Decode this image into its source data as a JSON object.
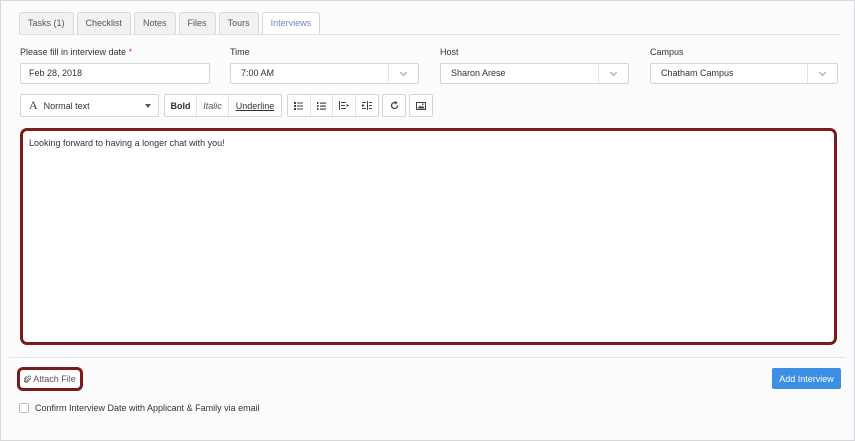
{
  "tabs": [
    {
      "label": "Tasks (1)",
      "active": false
    },
    {
      "label": "Checklist",
      "active": false
    },
    {
      "label": "Notes",
      "active": false
    },
    {
      "label": "Files",
      "active": false
    },
    {
      "label": "Tours",
      "active": false
    },
    {
      "label": "Interviews",
      "active": true
    }
  ],
  "form": {
    "date_label": "Please fill in interview date",
    "date_required_mark": "*",
    "date_value": "Feb 28, 2018",
    "time_label": "Time",
    "time_value": "7:00 AM",
    "host_label": "Host",
    "host_value": "Sharon Arese",
    "campus_label": "Campus",
    "campus_value": "Chatham Campus"
  },
  "toolbar": {
    "format_icon": "A",
    "format_value": "Normal text",
    "bold": "Bold",
    "italic": "Italic",
    "underline": "Underline",
    "icons": [
      "bullet-list-icon",
      "numbered-list-icon",
      "outdent-icon",
      "indent-icon",
      "undo-icon",
      "image-icon"
    ]
  },
  "editor": {
    "content": "Looking forward to having a longer chat with you!"
  },
  "footer": {
    "attach_label": "Attach File",
    "add_label": "Add Interview",
    "confirm_label": "Confirm Interview Date with Applicant & Family via email"
  },
  "colors": {
    "accent": "#3d8fe6",
    "highlight": "#7a1c1c",
    "active_tab_text": "#6b86c8",
    "required": "#c0392b"
  }
}
